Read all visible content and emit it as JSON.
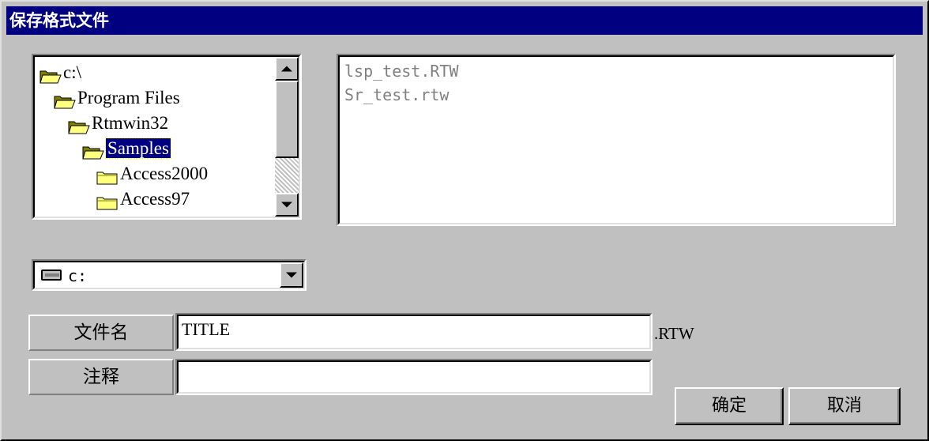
{
  "window": {
    "title": "保存格式文件"
  },
  "folder_tree": {
    "items": [
      {
        "label": "c:\\",
        "indent": 0,
        "open": true
      },
      {
        "label": "Program Files",
        "indent": 1,
        "open": true
      },
      {
        "label": "Rtmwin32",
        "indent": 2,
        "open": true
      },
      {
        "label": "Samples",
        "indent": 3,
        "open": true,
        "selected": true
      },
      {
        "label": "Access2000",
        "indent": 4,
        "open": false
      },
      {
        "label": "Access97",
        "indent": 4,
        "open": false
      }
    ]
  },
  "file_list": {
    "items": [
      "lsp_test.RTW",
      "Sr_test.rtw"
    ]
  },
  "drive_select": {
    "value": "c:"
  },
  "filename": {
    "label": "文件名",
    "value": "TITLE",
    "extension": ".RTW"
  },
  "comment": {
    "label": "注释",
    "value": ""
  },
  "buttons": {
    "ok": "确定",
    "cancel": "取消"
  },
  "colors": {
    "selection": "#000080",
    "title_bar": "#000080",
    "face": "#c0c0c0"
  }
}
